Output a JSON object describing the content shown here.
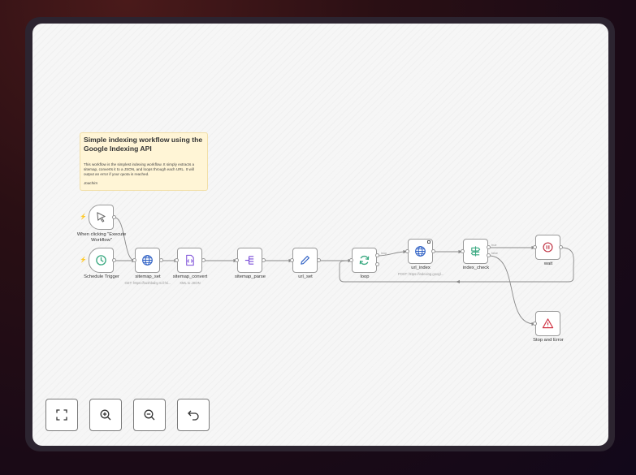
{
  "note": {
    "title": "Simple indexing workflow using the Google Indexing API",
    "body": "This workflow is the simplest indexing workflow. It simply extracts a sitemap, converts it to a JSON, and loops through each URL. It will output an error if your quota is reached.",
    "author": "Joachim"
  },
  "nodes": {
    "manual_trigger": {
      "label": "When clicking \"Execute Workflow\""
    },
    "schedule_trigger": {
      "label": "Schedule Trigger"
    },
    "sitemap_set": {
      "label": "sitemap_set",
      "sub": "GET: https://bushbaby.m.fr/si..."
    },
    "sitemap_convert": {
      "label": "sitemap_convert",
      "sub": "XML to JSON"
    },
    "sitemap_parse": {
      "label": "sitemap_parse"
    },
    "url_set": {
      "label": "url_set"
    },
    "loop": {
      "label": "loop"
    },
    "url_index": {
      "label": "url_index",
      "sub": "POST: https://indexing.googl..."
    },
    "index_check": {
      "label": "index_check"
    },
    "wait": {
      "label": "wait"
    },
    "stop_error": {
      "label": "Stop and Error"
    }
  },
  "edge_labels": {
    "loop_output": "loop",
    "if_true": "true",
    "if_false": "false"
  },
  "icons": {
    "manual_trigger": "cursor-icon",
    "schedule_trigger": "clock-icon",
    "sitemap_set": "globe-icon",
    "sitemap_convert": "code-file-icon",
    "sitemap_parse": "split-icon",
    "url_set": "pencil-icon",
    "loop": "refresh-icon",
    "url_index": "globe-icon",
    "index_check": "signpost-icon",
    "wait": "pause-icon",
    "stop_error": "warning-icon"
  },
  "controls": [
    "fullscreen-icon",
    "zoom-in-icon",
    "zoom-out-icon",
    "undo-icon"
  ],
  "colors": {
    "accent_green": "#3aa981",
    "accent_purple": "#7b4dd8",
    "error_red": "#d23a4a",
    "wait_red": "#c23a4a",
    "globe_blue": "#2d5fc4"
  }
}
